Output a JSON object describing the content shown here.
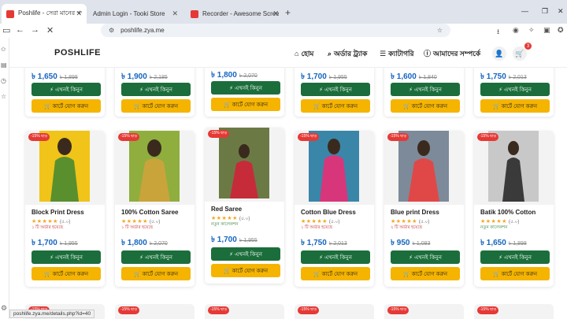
{
  "browser": {
    "tabs": [
      {
        "title": "Poshlife - সেরা মানের পণ্য",
        "color": "#e53935"
      },
      {
        "title": "Admin Login - Tooki Store",
        "color": "#555555"
      },
      {
        "title": "Recorder - Awesome Screensh",
        "color": "#e53935"
      }
    ],
    "url": "poshlife.zya.me",
    "status_url": "poshlife.zya.me/details.php?id=40"
  },
  "site": {
    "logo": "POSHLIFE",
    "nav": [
      {
        "icon": "home-icon",
        "glyph": "⌂",
        "label": "হোম"
      },
      {
        "icon": "search-icon",
        "glyph": "⌕",
        "label": "অর্ডার ট্র্যাক"
      },
      {
        "icon": "list-icon",
        "glyph": "☰",
        "label": "ক্যাটাগরি"
      },
      {
        "icon": "info-icon",
        "glyph": "ⓘ",
        "label": "আমাদের সম্পর্কে"
      }
    ],
    "cart_count": "3"
  },
  "labels": {
    "buy_now": "⚡ এখনই কিনুন",
    "add_cart": "🛒 কার্টে যোগ করুন",
    "discount": "-15% ছাড়"
  },
  "top_row": [
    {
      "price": "৳ 1,650",
      "old": "৳ 1,898"
    },
    {
      "price": "৳ 1,900",
      "old": "৳ 2,185"
    },
    {
      "price": "৳ 1,800",
      "old": "৳ 2,070"
    },
    {
      "price": "৳ 1,700",
      "old": "৳ 1,955"
    },
    {
      "price": "৳ 1,600",
      "old": "৳ 1,840"
    },
    {
      "price": "৳ 1,750",
      "old": "৳ 2,013"
    }
  ],
  "products": [
    {
      "name": "Block Print Dress",
      "stars": "★★★★★",
      "rating": "(৫.০)",
      "orders": "১ টি অর্ডার হয়েছে",
      "order_type": "red",
      "price": "৳ 1,700",
      "old": "৳ 1,955",
      "photo_bg": "#f0c419",
      "photo_fg": "#5a8f2e"
    },
    {
      "name": "100% Cotton Saree",
      "stars": "★★★★★",
      "rating": "(৫.০)",
      "orders": "১ টি অর্ডার হয়েছে",
      "order_type": "red",
      "price": "৳ 1,800",
      "old": "৳ 2,070",
      "photo_bg": "#8fae3e",
      "photo_fg": "#c9a43b"
    },
    {
      "name": "Red Saree",
      "stars": "★★★★★",
      "rating": "(৫.০)",
      "orders": "নতুন কালেকশন",
      "order_type": "green",
      "price": "৳ 1,700",
      "old": "৳ 1,955",
      "photo_bg": "#6b7a45",
      "photo_fg": "#c62b3a"
    },
    {
      "name": "Cotton Blue Dress",
      "stars": "★★★★★",
      "rating": "(৫.০)",
      "orders": "১ টি অর্ডার হয়েছে",
      "order_type": "red",
      "price": "৳ 1,750",
      "old": "৳ 2,013",
      "photo_bg": "#3a86a8",
      "photo_fg": "#d8367a"
    },
    {
      "name": "Blue print Dress",
      "stars": "★★★★★",
      "rating": "(৫.০)",
      "orders": "২ টি অর্ডার হয়েছে",
      "order_type": "red",
      "price": "৳ 950",
      "old": "৳ 1,093",
      "photo_bg": "#7d8a9a",
      "photo_fg": "#e04848"
    },
    {
      "name": "Batik 100% Cotton",
      "stars": "★★★★★",
      "rating": "(৫.০)",
      "orders": "নতুন কালেকশন",
      "order_type": "green",
      "price": "৳ 1,650",
      "old": "৳ 1,898",
      "photo_bg": "#c8c8c8",
      "photo_fg": "#3a3a3a"
    }
  ]
}
